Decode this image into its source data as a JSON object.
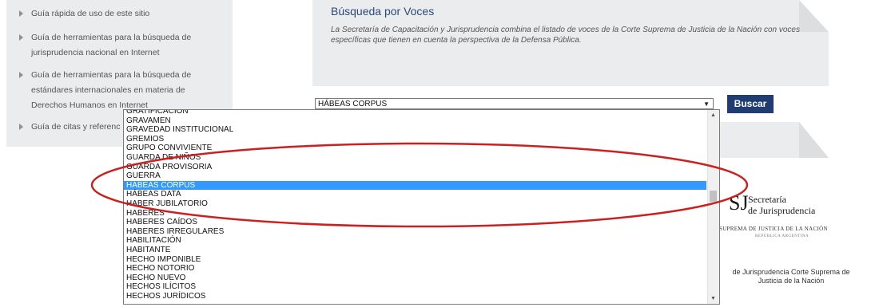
{
  "guides": [
    {
      "lines": [
        "Guía rápida de uso de este sitio"
      ]
    },
    {
      "lines": [
        "Guía de herramientas para la búsqueda de",
        "jurisprudencia nacional en Internet"
      ]
    },
    {
      "lines": [
        "Guía de herramientas para la búsqueda de",
        "estándares internacionales en materia de",
        "Derechos Humanos en Internet"
      ]
    },
    {
      "lines": [
        "Guía de citas y referenc"
      ]
    }
  ],
  "search": {
    "title": "Búsqueda por Voces",
    "description_line1": "La Secretaría de Capacitación y Jurisprudencia combina el listado de voces de la Corte Suprema de Justicia de la Nación con voces",
    "description_line2": "específicas que tienen en cuenta la perspectiva de la Defensa Pública.",
    "selected_value": "HÁBEAS CORPUS",
    "button_label": "Buscar"
  },
  "dropdown": {
    "options": [
      "GRATIFICACIÓN",
      "GRAVAMEN",
      "GRAVEDAD INSTITUCIONAL",
      "GREMIOS",
      "GRUPO CONVIVIENTE",
      "GUARDA DE NIÑOS",
      "GUARDA PROVISORIA",
      "GUERRA",
      "HÁBEAS CORPUS",
      "HÁBEAS DATA",
      "HABER JUBILATORIO",
      "HABERES",
      "HABERES CAÍDOS",
      "HABERES IRREGULARES",
      "HABILITACIÓN",
      "HABITANTE",
      "HECHO IMPONIBLE",
      "HECHO NOTORIO",
      "HECHO NUEVO",
      "HECHOS ILÍCITOS",
      "HECHOS JURÍDICOS"
    ],
    "selected_index": 8,
    "highlight_color": "#3399ff",
    "annotation_color": "#cc1f1f"
  },
  "logo": {
    "mark": "SJ",
    "line1": "Secretaría",
    "line2": "de Jurisprudencia",
    "sub1": "SUPREMA DE JUSTICIA DE LA NACIÓN",
    "sub2": "REPÚBLICA ARGENTINA",
    "caption_line1": "de Jurisprudencia Corte Suprema de",
    "caption_line2": "Justicia de la Nación"
  },
  "colors": {
    "panel_bg": "#ebeced",
    "button_bg": "#1f3d72",
    "title_color": "#2b4a7a"
  }
}
